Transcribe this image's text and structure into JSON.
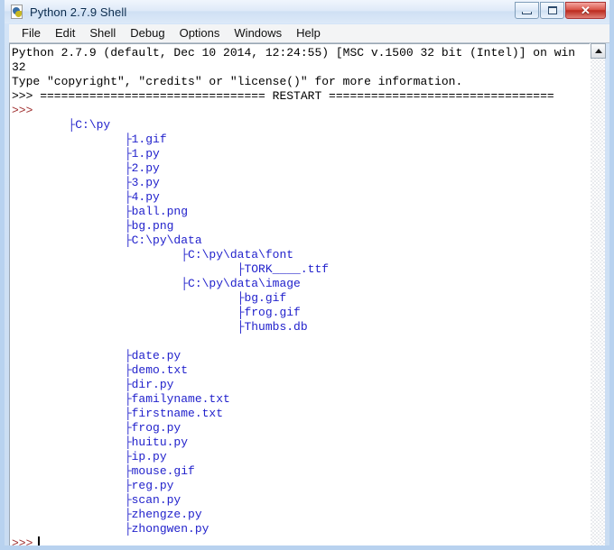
{
  "window": {
    "title": "Python 2.7.9 Shell",
    "icon": "python-idle-icon",
    "controls": {
      "minimize_label": "–",
      "maximize_label": "□",
      "close_label": "✕"
    }
  },
  "menubar": {
    "items": [
      {
        "label": "File"
      },
      {
        "label": "Edit"
      },
      {
        "label": "Shell"
      },
      {
        "label": "Debug"
      },
      {
        "label": "Options"
      },
      {
        "label": "Windows"
      },
      {
        "label": "Help"
      }
    ]
  },
  "shell": {
    "banner": [
      "Python 2.7.9 (default, Dec 10 2014, 12:24:55) [MSC v.1500 32 bit (Intel)] on win",
      "32",
      "Type \"copyright\", \"credits\" or \"license()\" for more information."
    ],
    "restart_line": ">>> ================================ RESTART ================================",
    "prompt_after_restart": ">>>",
    "final_prompt": ">>>",
    "cursor_visible": true,
    "tree_output": [
      "        ├C:\\py",
      "                ├1.gif",
      "                ├1.py",
      "                ├2.py",
      "                ├3.py",
      "                ├4.py",
      "                ├ball.png",
      "                ├bg.png",
      "                ├C:\\py\\data",
      "                        ├C:\\py\\data\\font",
      "                                ├TORK____.ttf",
      "                        ├C:\\py\\data\\image",
      "                                ├bg.gif",
      "                                ├frog.gif",
      "                                ├Thumbs.db",
      "",
      "                ├date.py",
      "                ├demo.txt",
      "                ├dir.py",
      "                ├familyname.txt",
      "                ├firstname.txt",
      "                ├frog.py",
      "                ├huitu.py",
      "                ├ip.py",
      "                ├mouse.gif",
      "                ├reg.py",
      "                ├scan.py",
      "                ├zhengze.py",
      "                ├zhongwen.py"
    ]
  },
  "scrollbar": {
    "up_arrow": "scroll-up-arrow",
    "position": "top"
  },
  "colors": {
    "tree_text": "#2222cc",
    "prompt_text": "#a03030",
    "body_text": "#000000",
    "window_border": "#b8d2ef",
    "close_button": "#bb2a1e"
  }
}
